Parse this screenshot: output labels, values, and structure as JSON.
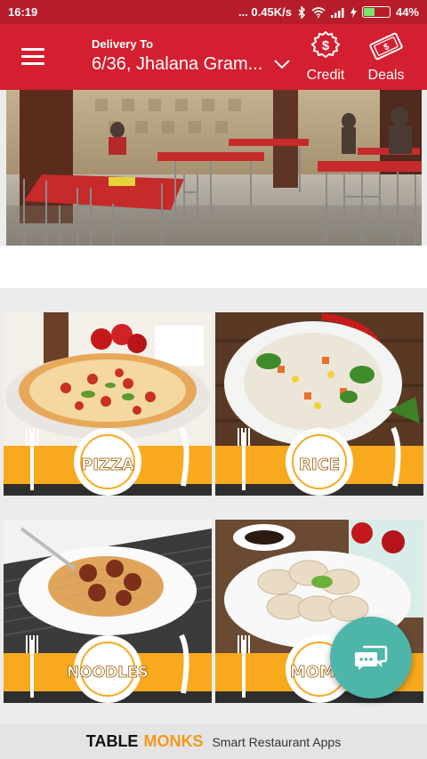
{
  "status_bar": {
    "time": "16:19",
    "speed": "... 0.45K/s",
    "battery_pct": "44%",
    "battery_level": 0.44
  },
  "header": {
    "delivery_label": "Delivery To",
    "address": "6/36, Jhalana Gram...",
    "credit_label": "Credit",
    "deals_label": "Deals",
    "accent": "#d31f30"
  },
  "categories": [
    {
      "label": "PIZZA"
    },
    {
      "label": "RICE"
    },
    {
      "label": "NOODLES"
    },
    {
      "label": "MOMO"
    }
  ],
  "footer": {
    "brand_part1": "TABLE",
    "brand_part2": "MONKS",
    "tagline": "Smart Restaurant Apps",
    "brand_color": "#f39a1e"
  }
}
